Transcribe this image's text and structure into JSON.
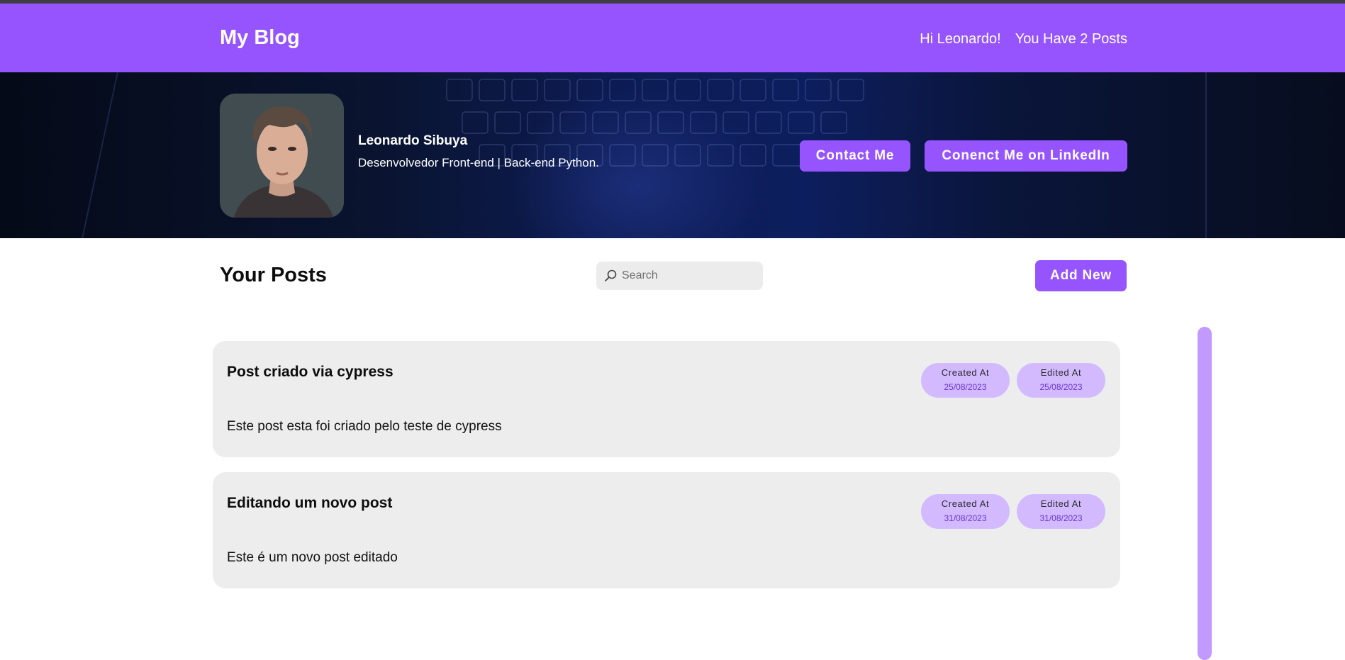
{
  "header": {
    "brand": "My Blog",
    "greeting": "Hi Leonardo!",
    "post_count": "You Have 2 Posts"
  },
  "profile": {
    "name": "Leonardo Sibuya",
    "role": "Desenvolvedor Front-end | Back-end Python.",
    "contact_label": "Contact Me",
    "linkedin_label": "Conenct Me on LinkedIn"
  },
  "posts_section": {
    "title": "Your Posts",
    "search_placeholder": "Search",
    "add_label": "Add New"
  },
  "posts": [
    {
      "title": "Post criado via cypress",
      "body": "Este post esta foi criado pelo teste de cypress",
      "created_label": "Created At",
      "created_date": "25/08/2023",
      "edited_label": "Edited At",
      "edited_date": "25/08/2023"
    },
    {
      "title": "Editando um novo post",
      "body": "Este é um novo post editado",
      "created_label": "Created At",
      "created_date": "31/08/2023",
      "edited_label": "Edited At",
      "edited_date": "31/08/2023"
    }
  ],
  "colors": {
    "accent": "#9654ff",
    "pill": "#d3baff",
    "card": "#ededed",
    "scrollbar": "#c199ff"
  },
  "icons": {
    "search": "search-icon"
  }
}
